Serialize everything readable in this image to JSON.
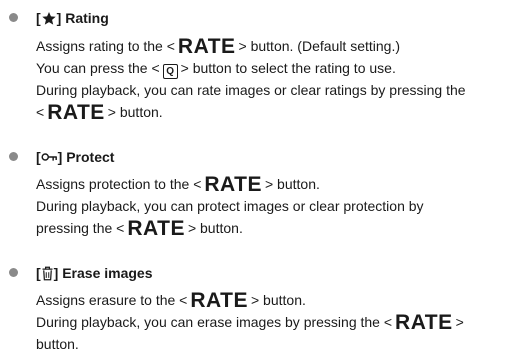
{
  "rating": {
    "heading_open": "[",
    "heading_icon": "star-icon",
    "heading_close": "] Rating",
    "line1_a": "Assigns rating to the <",
    "line1_rate": "RATE",
    "line1_b": "> button. (Default setting.)",
    "line2_a": "You can press the <",
    "line2_q": "Q",
    "line2_b": "> button to select the rating to use.",
    "line3": "During playback, you can rate images or clear ratings by pressing the",
    "line4_a": "<",
    "line4_rate": "RATE",
    "line4_b": "> button."
  },
  "protect": {
    "heading_open": "[",
    "heading_icon": "key-icon",
    "heading_close": "] Protect",
    "line1_a": "Assigns protection to the <",
    "line1_rate": "RATE",
    "line1_b": "> button.",
    "line2": "During playback, you can protect images or clear protection by",
    "line3_a": "pressing the <",
    "line3_rate": "RATE",
    "line3_b": "> button."
  },
  "erase": {
    "heading_open": "[",
    "heading_icon": "trash-icon",
    "heading_close": "] Erase images",
    "line1_a": "Assigns erasure to the <",
    "line1_rate": "RATE",
    "line1_b": "> button.",
    "line2_a": "During playback, you can erase images by pressing the <",
    "line2_rate": "RATE",
    "line2_b": ">",
    "line3": "button."
  }
}
